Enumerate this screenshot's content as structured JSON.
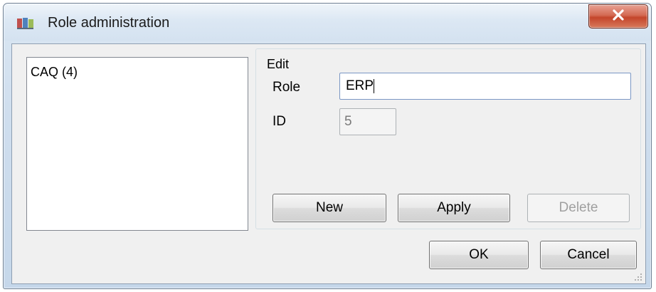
{
  "window": {
    "title": "Role administration",
    "close_icon": "close-x-icon",
    "app_icon": "app-icon"
  },
  "roles_list": {
    "items": [
      {
        "label": "CAQ (4)"
      }
    ]
  },
  "edit_group": {
    "label": "Edit",
    "role_label": "Role",
    "role_value": "ERP",
    "id_label": "ID",
    "id_value": "5"
  },
  "buttons": {
    "new": "New",
    "apply": "Apply",
    "delete": "Delete",
    "ok": "OK",
    "cancel": "Cancel"
  },
  "colors": {
    "close_button": "#c4452b",
    "title_bar": "#cfdeee",
    "dialog_background": "#f0f0f0"
  }
}
